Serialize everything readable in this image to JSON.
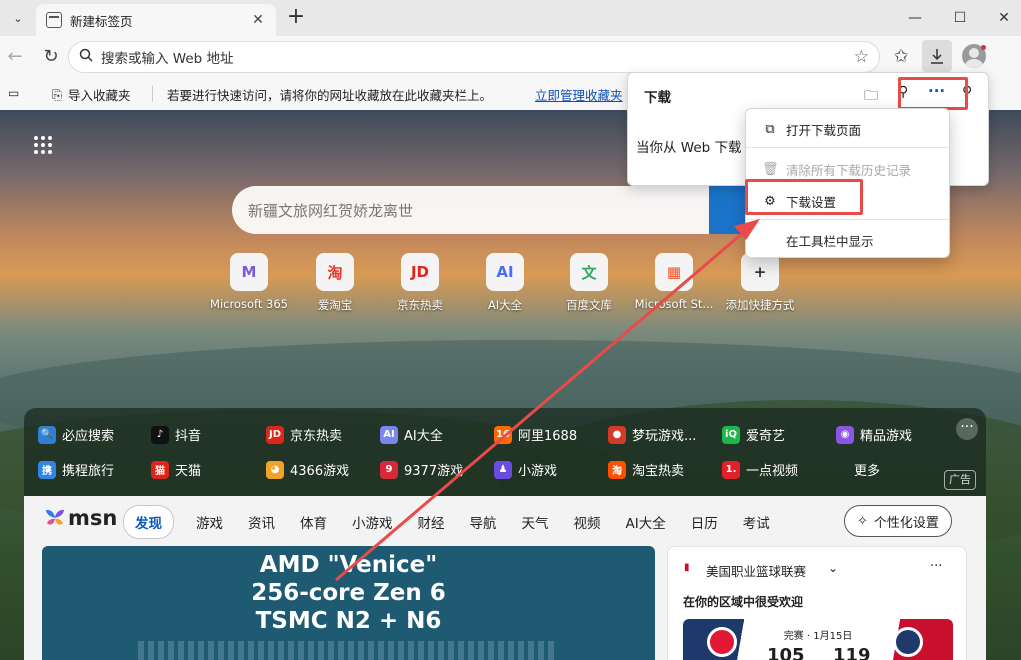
{
  "tab": {
    "title": "新建标签页"
  },
  "window": {
    "minimize": "—",
    "maximize": "☐",
    "close": "✕"
  },
  "address": {
    "placeholder": "搜索或输入 Web 地址"
  },
  "favorites_bar": {
    "import_label": "导入收藏夹",
    "hint": "若要进行快速访问，请将你的网址收藏放在此收藏夹栏上。",
    "manage_link": "立即管理收藏夹"
  },
  "downloads_panel": {
    "title": "下载",
    "empty_text": "当你从 Web 下载",
    "menu": [
      {
        "label": "打开下载页面",
        "icon": "open-external-icon",
        "enabled": true
      },
      {
        "label": "清除所有下载历史记录",
        "icon": "trash-icon",
        "enabled": false
      },
      {
        "label": "下载设置",
        "icon": "gear-icon",
        "enabled": true
      },
      {
        "label": "在工具栏中显示",
        "icon": "",
        "enabled": true
      }
    ]
  },
  "search": {
    "placeholder": "新疆文旅网红贺娇龙离世"
  },
  "shortcuts": [
    {
      "label": "Microsoft 365",
      "icon": "M",
      "color": "#7b5cd6"
    },
    {
      "label": "爱淘宝",
      "icon": "淘",
      "color": "#e83a2e"
    },
    {
      "label": "京东热卖",
      "icon": "JD",
      "color": "#e1251b"
    },
    {
      "label": "AI大全",
      "icon": "AI",
      "color": "#4a6cf7"
    },
    {
      "label": "百度文库",
      "icon": "文",
      "color": "#2aa85a"
    },
    {
      "label": "Microsoft St...",
      "icon": "▦",
      "color": "#f25022"
    },
    {
      "label": "添加快捷方式",
      "icon": "+",
      "color": "#333333"
    }
  ],
  "links_row1": [
    {
      "label": "必应搜索",
      "icon": "🔍",
      "color": "#2f7fd6"
    },
    {
      "label": "抖音",
      "icon": "♪",
      "color": "#111111"
    },
    {
      "label": "京东热卖",
      "icon": "JD",
      "color": "#e1251b"
    },
    {
      "label": "AI大全",
      "icon": "AI",
      "color": "#7a86f0"
    },
    {
      "label": "阿里1688",
      "icon": "16",
      "color": "#ff6a00"
    },
    {
      "label": "梦玩游戏...",
      "icon": "●",
      "color": "#d43a2a"
    },
    {
      "label": "爱奇艺",
      "icon": "iQ",
      "color": "#1db64a"
    },
    {
      "label": "精品游戏",
      "icon": "◉",
      "color": "#8a56e2"
    }
  ],
  "links_row2": [
    {
      "label": "携程旅行",
      "icon": "携",
      "color": "#2f86e6"
    },
    {
      "label": "天猫",
      "icon": "猫",
      "color": "#e2231a"
    },
    {
      "label": "4366游戏",
      "icon": "◕",
      "color": "#f2a229"
    },
    {
      "label": "9377游戏",
      "icon": "9",
      "color": "#d9283a"
    },
    {
      "label": "小游戏",
      "icon": "♟",
      "color": "#6a4de0"
    },
    {
      "label": "淘宝热卖",
      "icon": "淘",
      "color": "#ff5000"
    },
    {
      "label": "一点视频",
      "icon": "1.",
      "color": "#e41e2b"
    },
    {
      "label": "更多",
      "icon": "",
      "color": ""
    }
  ],
  "ad_label": "广告",
  "msn": {
    "logo": "msn",
    "tabs": [
      "发现",
      "游戏",
      "资讯",
      "体育",
      "小游戏",
      "财经",
      "导航",
      "天气",
      "视频",
      "AI大全",
      "日历",
      "考试"
    ],
    "personalize": "个性化设置"
  },
  "news": {
    "lines": [
      "AMD \"Venice\"",
      "256-core Zen 6",
      "TSMC N2 + N6"
    ]
  },
  "nba": {
    "league": "美国职业篮球联赛",
    "subtitle": "在你的区域中很受欢迎",
    "status": "完赛 · 1月15日",
    "score_left": "105",
    "score_right": "119"
  }
}
